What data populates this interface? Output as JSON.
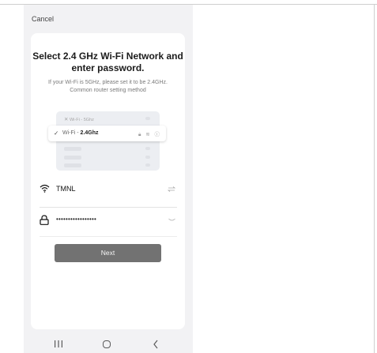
{
  "header": {
    "cancel_label": "Cancel"
  },
  "main": {
    "title": "Select 2.4 GHz Wi-Fi Network and enter password.",
    "description": "If your Wi-Fi is 5GHz, please set it to be 2.4GHz. Common router setting method"
  },
  "illustration": {
    "row_5g_prefix": "Wi-Fi - ",
    "row_5g_band": "5Ghz",
    "row_24g_prefix": "Wi-Fi - ",
    "row_24g_band": "2.4Ghz"
  },
  "wifi": {
    "ssid": "TMNL",
    "icon": "wifi-icon",
    "switch_icon": "switch-network-icon"
  },
  "password": {
    "masked_value": "•••••••••••••••••",
    "icon": "lock-icon",
    "toggle_icon": "eye-closed-icon"
  },
  "actions": {
    "next_label": "Next"
  },
  "colors": {
    "background": "#f2f2f4",
    "card": "#ffffff",
    "next_button": "#727272"
  }
}
